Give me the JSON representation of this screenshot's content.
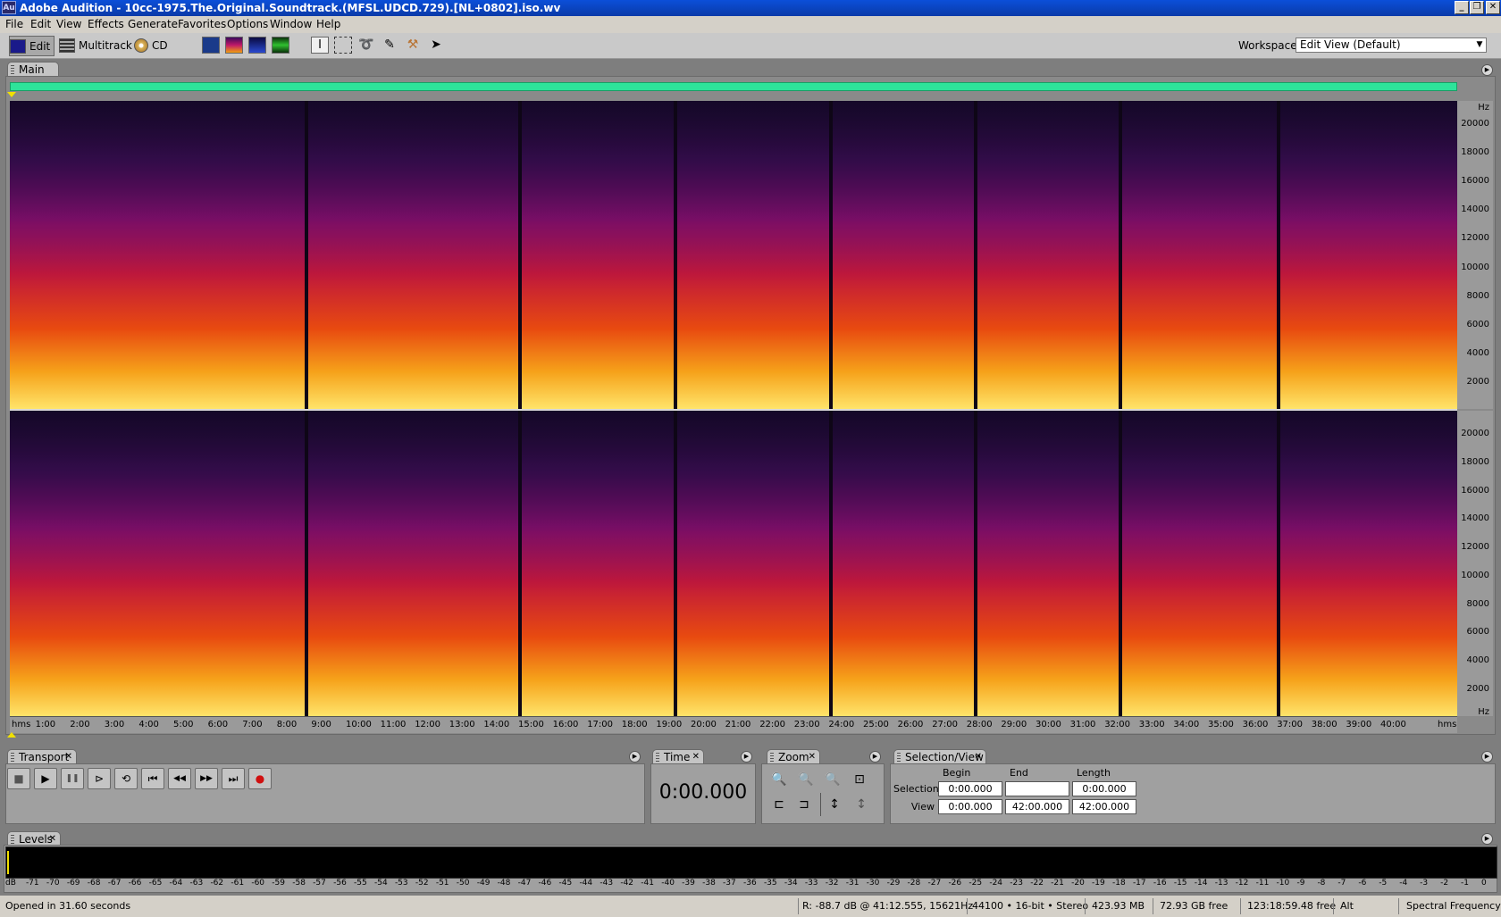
{
  "window": {
    "app_icon": "Au",
    "title": "Adobe Audition - 10cc-1975.The.Original.Soundtrack.(MFSL.UDCD.729).[NL+0802].iso.wv",
    "controls": [
      "_",
      "❐",
      "✕"
    ]
  },
  "menubar": [
    "File",
    "Edit",
    "View",
    "Effects",
    "Generate",
    "Favorites",
    "Options",
    "Window",
    "Help"
  ],
  "toolbar": {
    "modes": [
      {
        "label": "Edit",
        "icon": "waveform-edit-icon"
      },
      {
        "label": "Multitrack",
        "icon": "multitrack-icon"
      },
      {
        "label": "CD",
        "icon": "cd-icon"
      }
    ],
    "view_buttons": [
      "waveform-view-icon",
      "spectral-frequency-view-icon",
      "spectral-pan-view-icon",
      "spectral-phase-view-icon"
    ],
    "tools": [
      "time-selection-tool-icon",
      "marquee-tool-icon",
      "lasso-tool-icon",
      "effects-paintbrush-icon",
      "spot-healing-brush-icon",
      "scrub-tool-icon"
    ],
    "workspace_label": "Workspace:",
    "workspace_value": "Edit View (Default)"
  },
  "main_panel": {
    "tab_label": "Main",
    "frequency_unit": "Hz",
    "frequency_ticks": [
      "20000",
      "18000",
      "16000",
      "14000",
      "12000",
      "10000",
      "8000",
      "6000",
      "4000",
      "2000"
    ],
    "time_unit": "hms",
    "time_ticks": [
      "1:00",
      "2:00",
      "3:00",
      "4:00",
      "5:00",
      "6:00",
      "7:00",
      "8:00",
      "9:00",
      "10:00",
      "11:00",
      "12:00",
      "13:00",
      "14:00",
      "15:00",
      "16:00",
      "17:00",
      "18:00",
      "19:00",
      "20:00",
      "21:00",
      "22:00",
      "23:00",
      "24:00",
      "25:00",
      "26:00",
      "27:00",
      "28:00",
      "29:00",
      "30:00",
      "31:00",
      "32:00",
      "33:00",
      "34:00",
      "35:00",
      "36:00",
      "37:00",
      "38:00",
      "39:00",
      "40:00"
    ],
    "track_boundaries_minutes": [
      8.6,
      14.8,
      19.3,
      23.8,
      28.0,
      32.2,
      36.8
    ]
  },
  "transport": {
    "tab_label": "Transport",
    "buttons": [
      {
        "icon": "stop-icon",
        "glyph": "■"
      },
      {
        "icon": "play-icon",
        "glyph": "▶"
      },
      {
        "icon": "pause-icon",
        "glyph": "❚❚"
      },
      {
        "icon": "play-from-cursor-icon",
        "glyph": "⊳"
      },
      {
        "icon": "loop-icon",
        "glyph": "⟲"
      },
      {
        "icon": "go-to-start-icon",
        "glyph": "⏮"
      },
      {
        "icon": "rewind-icon",
        "glyph": "◀◀"
      },
      {
        "icon": "fast-forward-icon",
        "glyph": "▶▶"
      },
      {
        "icon": "go-to-end-icon",
        "glyph": "⏭"
      },
      {
        "icon": "record-icon",
        "glyph": "●"
      }
    ]
  },
  "time_panel": {
    "tab_label": "Time",
    "value": "0:00.000"
  },
  "zoom_panel": {
    "tab_label": "Zoom",
    "buttons": [
      "zoom-in-horizontal-icon",
      "zoom-out-horizontal-icon",
      "zoom-out-full-icon",
      "zoom-to-selection-icon",
      "zoom-left-icon",
      "zoom-right-icon",
      "zoom-in-vertical-icon",
      "zoom-out-vertical-icon"
    ]
  },
  "selection_view": {
    "tab_label": "Selection/View",
    "headers": [
      "Begin",
      "End",
      "Length"
    ],
    "selection": {
      "label": "Selection",
      "begin": "0:00.000",
      "end": "",
      "length": "0:00.000"
    },
    "view": {
      "label": "View",
      "begin": "0:00.000",
      "end": "42:00.000",
      "length": "42:00.000"
    }
  },
  "levels": {
    "tab_label": "Levels",
    "scale": [
      "dB",
      "-71",
      "-70",
      "-69",
      "-68",
      "-67",
      "-66",
      "-65",
      "-64",
      "-63",
      "-62",
      "-61",
      "-60",
      "-59",
      "-58",
      "-57",
      "-56",
      "-55",
      "-54",
      "-53",
      "-52",
      "-51",
      "-50",
      "-49",
      "-48",
      "-47",
      "-46",
      "-45",
      "-44",
      "-43",
      "-42",
      "-41",
      "-40",
      "-39",
      "-38",
      "-37",
      "-36",
      "-35",
      "-34",
      "-33",
      "-32",
      "-31",
      "-30",
      "-29",
      "-28",
      "-27",
      "-26",
      "-25",
      "-24",
      "-23",
      "-22",
      "-21",
      "-20",
      "-19",
      "-18",
      "-17",
      "-16",
      "-15",
      "-14",
      "-13",
      "-12",
      "-11",
      "-10",
      "-9",
      "-8",
      "-7",
      "-6",
      "-5",
      "-4",
      "-3",
      "-2",
      "-1",
      "0"
    ]
  },
  "statusbar": {
    "message": "Opened in 31.60 seconds",
    "cursor_info": "R: -88.7 dB @ 41:12.555, 15621Hz",
    "format": "44100 • 16-bit • Stereo",
    "file_size": "423.93 MB",
    "disk_free": "72.93 GB free",
    "time_free": "123:18:59.48 free",
    "keyboard": "Alt",
    "view_mode": "Spectral Frequency"
  },
  "colors": {
    "titlebar": "#0a3aa8",
    "overview": "#2ee39a",
    "record": "#d01010"
  }
}
